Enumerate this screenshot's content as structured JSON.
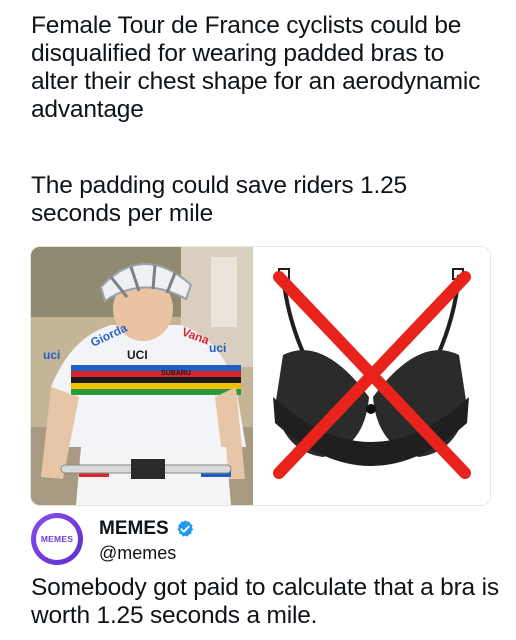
{
  "post": {
    "headline": "Female Tour de France cyclists could be disqualified for wearing padded bras to alter their chest shape for an aerodynamic advantage",
    "subline": "The padding could save riders 1.25 seconds per mile"
  },
  "media": {
    "left_image": "cyclist-photo",
    "jersey_text": [
      "Giorda",
      "Vana",
      "uci",
      "uci",
      "UCI",
      "SUBARU"
    ],
    "right_image": "black-bra-crossed-out",
    "cross_color": "#e8231b"
  },
  "account": {
    "display_name": "MEMES",
    "handle": "@memes",
    "avatar_text": "MEMES",
    "avatar_color": "#7a44e8",
    "verified_color": "#1d9bf0"
  },
  "caption": "Somebody got paid to calculate that a bra is worth 1.25 seconds a mile."
}
